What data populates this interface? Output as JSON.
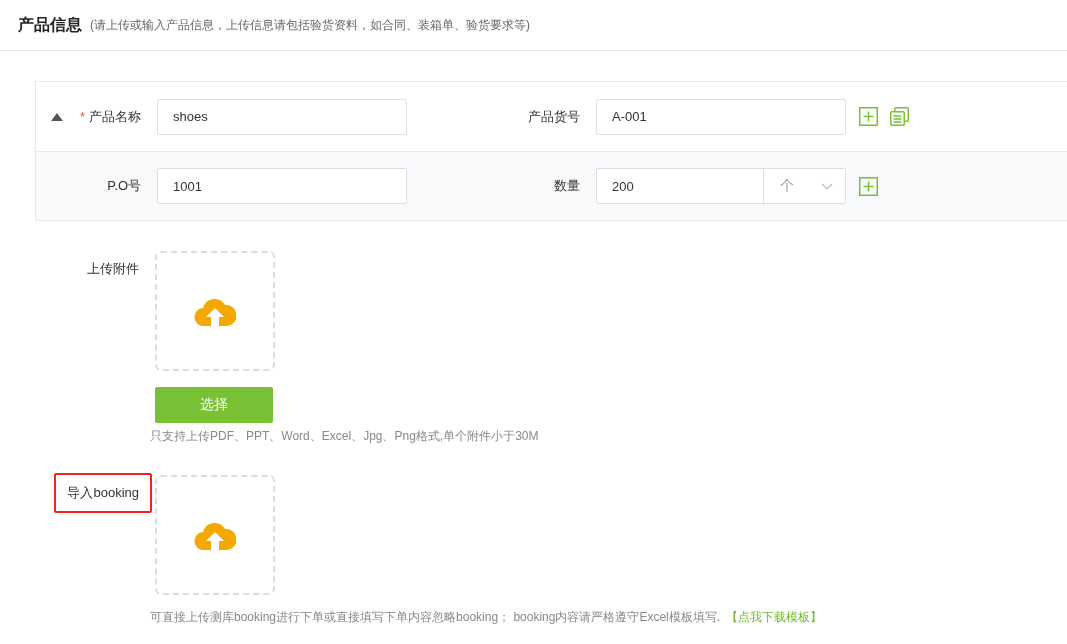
{
  "header": {
    "title": "产品信息",
    "subtitle": "(请上传或输入产品信息，上传信息请包括验货资料，如合同、装箱单、验货要求等)"
  },
  "product_panel": {
    "expanded": true,
    "rows": [
      {
        "fields": [
          {
            "label": "产品名称",
            "required_mark": "*",
            "value": "shoes"
          },
          {
            "label": "产品货号",
            "value": "A-001"
          }
        ],
        "actions": [
          {
            "kind": "add"
          },
          {
            "kind": "copy"
          }
        ]
      },
      {
        "fields": [
          {
            "label": "P.O号",
            "value": "1001"
          },
          {
            "label": "数量",
            "value": "200",
            "unit": "个"
          }
        ],
        "actions": [
          {
            "kind": "add"
          }
        ]
      }
    ]
  },
  "uploads": [
    {
      "label": "上传附件",
      "highlighted": false,
      "button": "选择",
      "hint": "只支持上传PDF、PPT、Word、Excel、Jpg、Png格式,单个附件小于30M"
    },
    {
      "label": "导入booking",
      "highlighted": true,
      "hint": "可直接上传测库booking进行下单或直接填写下单内容忽略booking； booking内容请严格遵守Excel模板填写.",
      "link": "【点我下载模板】"
    }
  ]
}
